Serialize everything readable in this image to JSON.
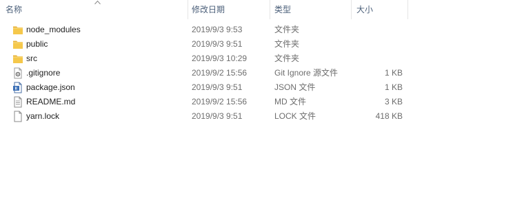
{
  "columns": {
    "name": "名称",
    "date_modified": "修改日期",
    "type": "类型",
    "size": "大小"
  },
  "files": [
    {
      "name": "node_modules",
      "date": "2019/9/3 9:53",
      "type": "文件夹",
      "size": "",
      "icon": "folder-icon"
    },
    {
      "name": "public",
      "date": "2019/9/3 9:51",
      "type": "文件夹",
      "size": "",
      "icon": "folder-icon"
    },
    {
      "name": "src",
      "date": "2019/9/3 10:29",
      "type": "文件夹",
      "size": "",
      "icon": "folder-icon"
    },
    {
      "name": ".gitignore",
      "date": "2019/9/2 15:56",
      "type": "Git Ignore 源文件",
      "size": "1 KB",
      "icon": "gitignore-file-icon"
    },
    {
      "name": "package.json",
      "date": "2019/9/3 9:51",
      "type": "JSON 文件",
      "size": "1 KB",
      "icon": "json-file-icon"
    },
    {
      "name": "README.md",
      "date": "2019/9/2 15:56",
      "type": "MD 文件",
      "size": "3 KB",
      "icon": "markdown-file-icon"
    },
    {
      "name": "yarn.lock",
      "date": "2019/9/3 9:51",
      "type": "LOCK 文件",
      "size": "418 KB",
      "icon": "generic-file-icon"
    }
  ],
  "colors": {
    "folder": "#f5c84b",
    "header_text": "#4c607a"
  }
}
